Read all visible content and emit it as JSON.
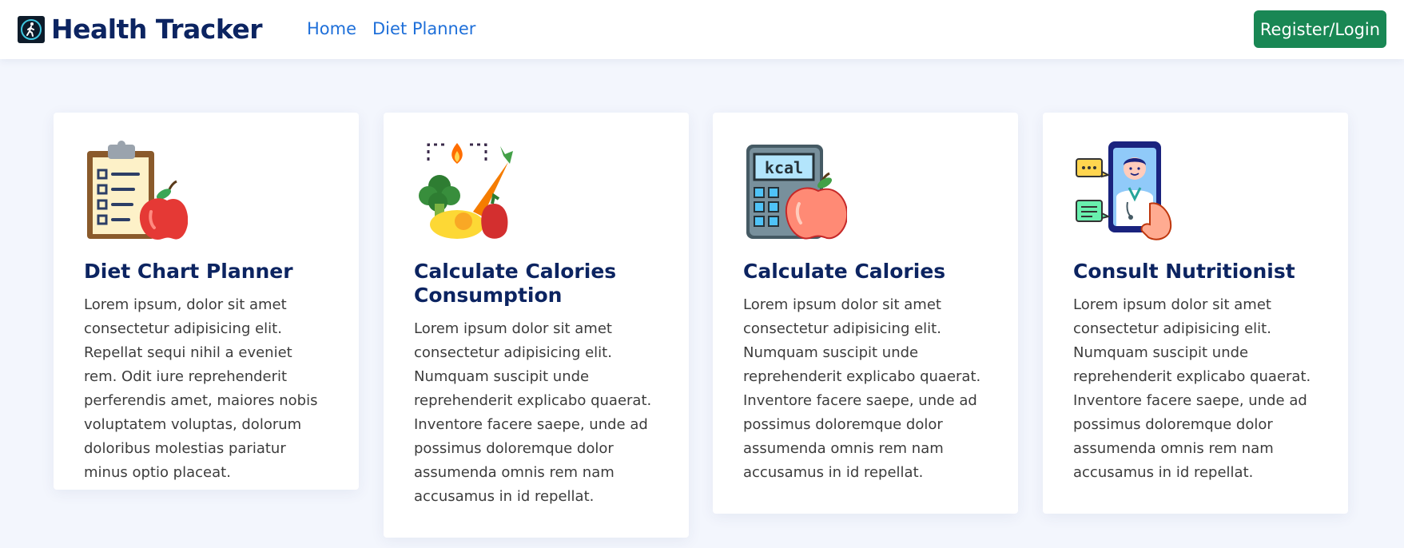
{
  "header": {
    "brand": "Health Tracker",
    "nav": [
      "Home",
      "Diet Planner"
    ],
    "login_label": "Register/Login"
  },
  "cards": [
    {
      "title": "Diet Chart Planner",
      "text": "Lorem ipsum, dolor sit amet consectetur adipisicing elit. Repellat sequi nihil a eveniet rem. Odit iure reprehenderit perferendis amet, maiores nobis voluptatem voluptas, dolorum doloribus molestias pariatur minus optio placeat.",
      "icon": "clipboard-apple-icon"
    },
    {
      "title": "Calculate Calories Consumption",
      "text": "Lorem ipsum dolor sit amet consectetur adipisicing elit. Numquam suscipit unde reprehenderit explicabo quaerat. Inventore facere saepe, unde ad possimus doloremque dolor assumenda omnis rem nam accusamus in id repellat.",
      "icon": "vegetables-icon"
    },
    {
      "title": "Calculate Calories",
      "text": "Lorem ipsum dolor sit amet consectetur adipisicing elit. Numquam suscipit unde reprehenderit explicabo quaerat. Inventore facere saepe, unde ad possimus doloremque dolor assumenda omnis rem nam accusamus in id repellat.",
      "icon": "kcal-calculator-icon",
      "icon_label": "kcal"
    },
    {
      "title": "Consult Nutritionist",
      "text": "Lorem ipsum dolor sit amet consectetur adipisicing elit. Numquam suscipit unde reprehenderit explicabo quaerat. Inventore facere saepe, unde ad possimus doloremque dolor assumenda omnis rem nam accusamus in id repellat.",
      "icon": "doctor-phone-icon"
    }
  ],
  "colors": {
    "brand": "#0c2461",
    "link": "#1e6fd9",
    "button": "#198754",
    "background": "#f3f6fd"
  }
}
